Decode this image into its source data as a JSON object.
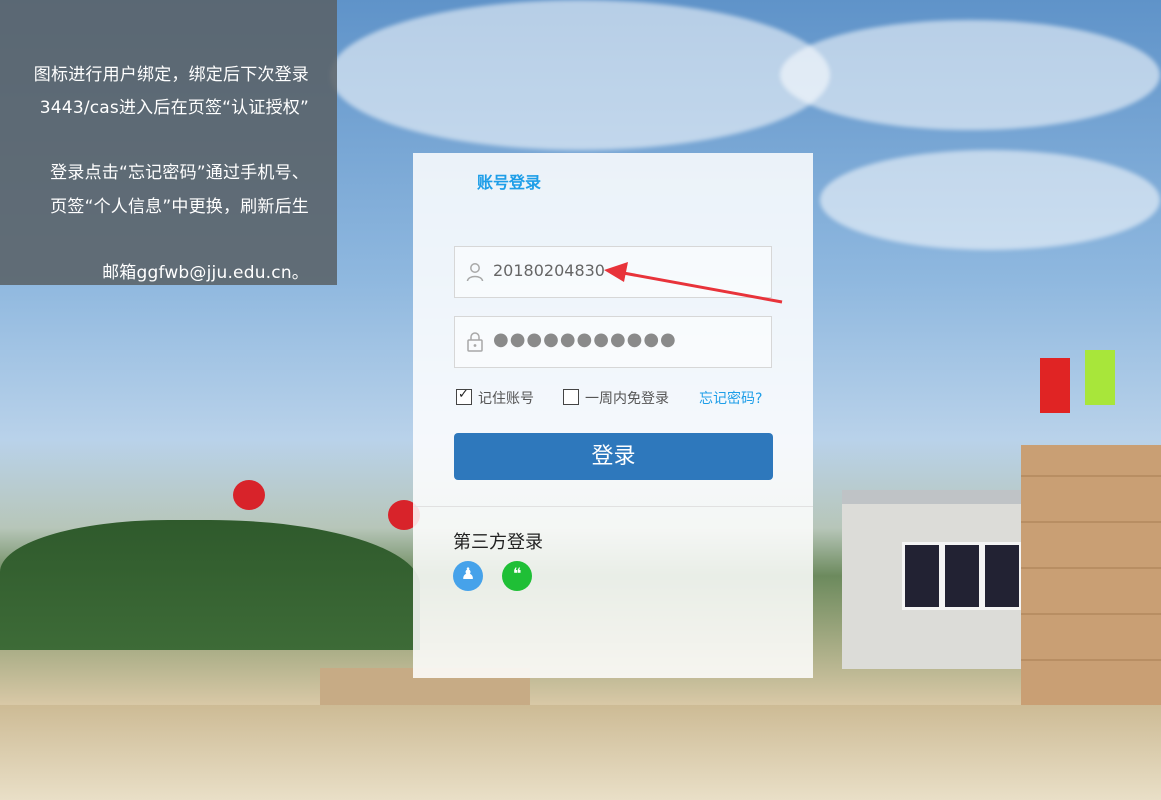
{
  "notice": {
    "lines": [
      "图标进行用户绑定，绑定后下次登录",
      "3443/cas进入后在页签“认证授权”",
      "登录点击“忘记密码”通过手机号、",
      "页签“个人信息”中更换，刷新后生",
      "邮箱ggfwb@jju.edu.cn。"
    ]
  },
  "login": {
    "tab_label": "账号登录",
    "username_value": "20180204830",
    "username_icon": "user-icon",
    "password_mask": "●●●●●●●●●●●",
    "password_icon": "lock-icon",
    "remember_label": "记住账号",
    "remember_checked": true,
    "week_label": "一周内免登录",
    "week_checked": false,
    "forgot_label": "忘记密码?",
    "submit_label": "登录"
  },
  "third_party": {
    "title": "第三方登录",
    "providers": [
      {
        "name": "qq",
        "icon": "qq-icon",
        "color": "#46a2ea"
      },
      {
        "name": "wechat",
        "icon": "wechat-icon",
        "color": "#1fbf36"
      }
    ]
  },
  "colors": {
    "accent": "#1e9ee8",
    "button": "#2e78bc",
    "annotation_arrow": "#e8333a"
  }
}
